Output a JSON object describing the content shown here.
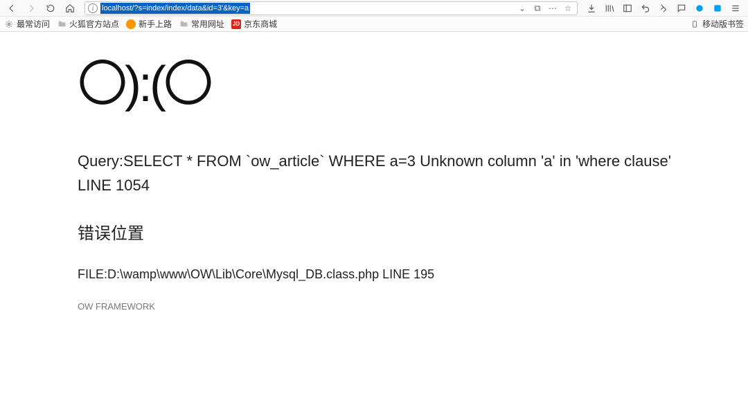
{
  "nav": {
    "url": "localhost/?s=index/index/data&id=3'&key=a"
  },
  "bookmarks_bar": {
    "items": [
      {
        "label": "最常访问"
      },
      {
        "label": "火狐官方站点"
      },
      {
        "label": "新手上路"
      },
      {
        "label": "常用网址"
      },
      {
        "label": "京东商城",
        "badge": "JD"
      }
    ],
    "right_label": "移动版书签"
  },
  "page": {
    "face": "〇):(〇",
    "query_text": "Query:SELECT * FROM `ow_article` WHERE a=3 Unknown column 'a' in 'where clause'",
    "line_text": "LINE 1054",
    "location_heading": "错误位置",
    "file_text": "FILE:D:\\wamp\\www\\OW\\Lib\\Core\\Mysql_DB.class.php  LINE  195",
    "framework": "OW FRAMEWORK"
  }
}
